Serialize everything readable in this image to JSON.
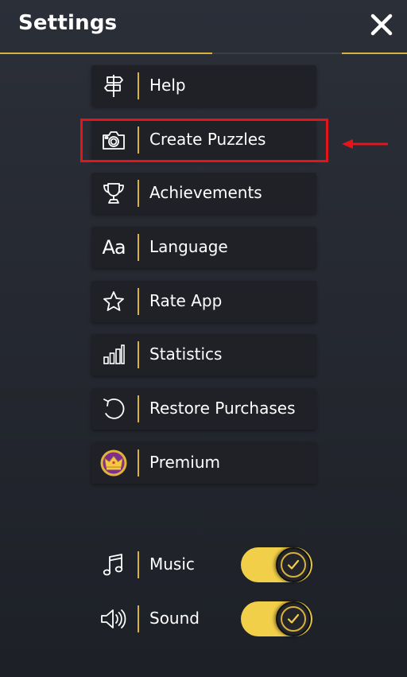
{
  "header": {
    "title": "Settings",
    "close_icon": "close-icon",
    "accent_color": "#d8b23d"
  },
  "menu": {
    "items": [
      {
        "label": "Help",
        "icon": "signpost-icon"
      },
      {
        "label": "Create Puzzles",
        "icon": "camera-icon",
        "highlighted": true
      },
      {
        "label": "Achievements",
        "icon": "trophy-icon"
      },
      {
        "label": "Language",
        "icon": "language-icon"
      },
      {
        "label": "Rate App",
        "icon": "star-icon"
      },
      {
        "label": "Statistics",
        "icon": "bar-chart-icon"
      },
      {
        "label": "Restore Purchases",
        "icon": "restore-icon"
      },
      {
        "label": "Premium",
        "icon": "crown-badge-icon"
      }
    ],
    "highlight_color": "#e3151a"
  },
  "language_icon_text": "Aa",
  "toggles": [
    {
      "label": "Music",
      "icon": "music-note-icon",
      "on": true
    },
    {
      "label": "Sound",
      "icon": "speaker-icon",
      "on": true
    }
  ]
}
